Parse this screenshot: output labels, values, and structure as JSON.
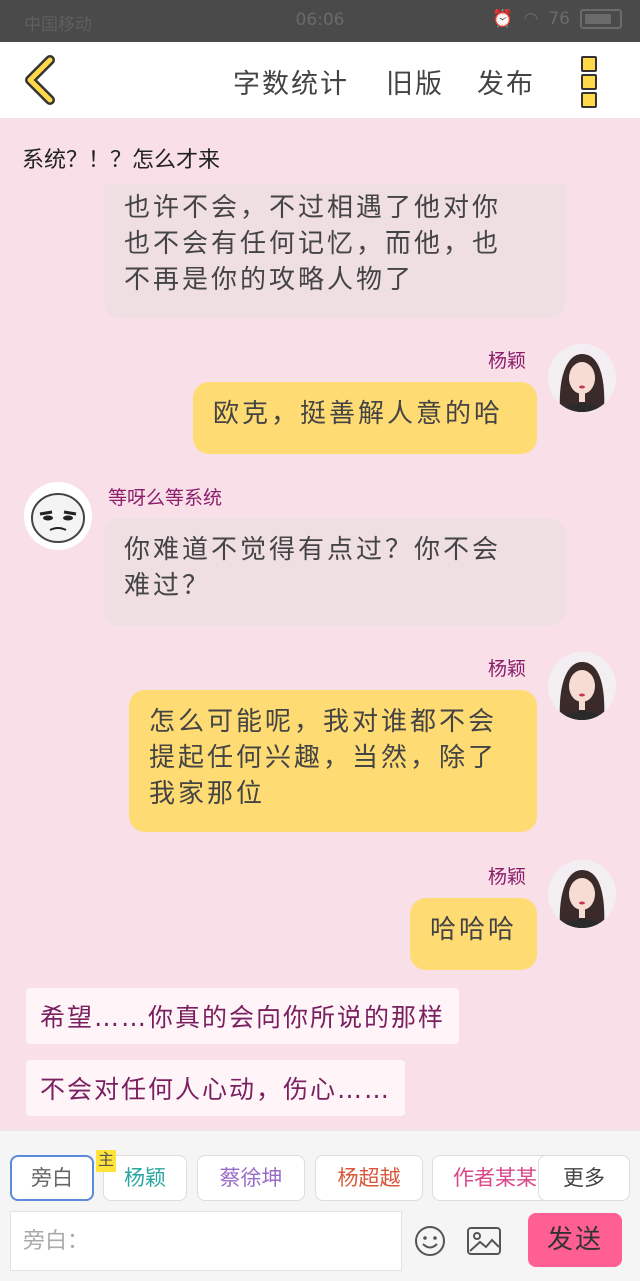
{
  "statusbar": {
    "left": "中国移动",
    "time": "06:06",
    "battery": "76"
  },
  "header": {
    "back_icon": "chevron-left-icon",
    "word_count": "字数统计",
    "old_version": "旧版",
    "publish": "发布",
    "more_icon": "more-vertical-icon"
  },
  "messages": {
    "system_line": "系统？！？怎么才来",
    "m1": {
      "lines": [
        "也许不会，不过相遇了他对你",
        "也不会有任何记忆，而他，也",
        "不再是你的攻略人物了"
      ]
    },
    "m2": {
      "name": "杨颖",
      "text": "欧克，挺善解人意的哈"
    },
    "m3": {
      "name": "等呀么等系统",
      "lines": [
        "你难道不觉得有点过？你不会",
        "难过？"
      ]
    },
    "m4": {
      "name": "杨颖",
      "lines": [
        "怎么可能呢，我对谁都不会",
        "提起任何兴趣，当然，除了",
        "我家那位"
      ]
    },
    "m5": {
      "name": "杨颖",
      "text": "哈哈哈"
    },
    "n1": "希望……你真的会向你所说的那样",
    "n2": "不会对任何人心动，伤心……"
  },
  "footer": {
    "roles": [
      {
        "label": "旁白",
        "color": "#666666"
      },
      {
        "label": "杨颖",
        "color": "#2aa6a0",
        "badge": "主"
      },
      {
        "label": "蔡徐坤",
        "color": "#9a6cc7"
      },
      {
        "label": "杨超越",
        "color": "#d9573b"
      },
      {
        "label": "作者某某",
        "color": "#d9488a"
      }
    ],
    "more": "更多",
    "input_placeholder": "旁白：",
    "emoji_icon": "smiley-icon",
    "image_icon": "image-icon",
    "send": "发送"
  },
  "colors": {
    "background": "#f9dfe7",
    "bubble_left": "#f0dfe2",
    "bubble_right": "#ffdb73",
    "name": "#8b1e6b",
    "send_button": "#ff5f93"
  }
}
